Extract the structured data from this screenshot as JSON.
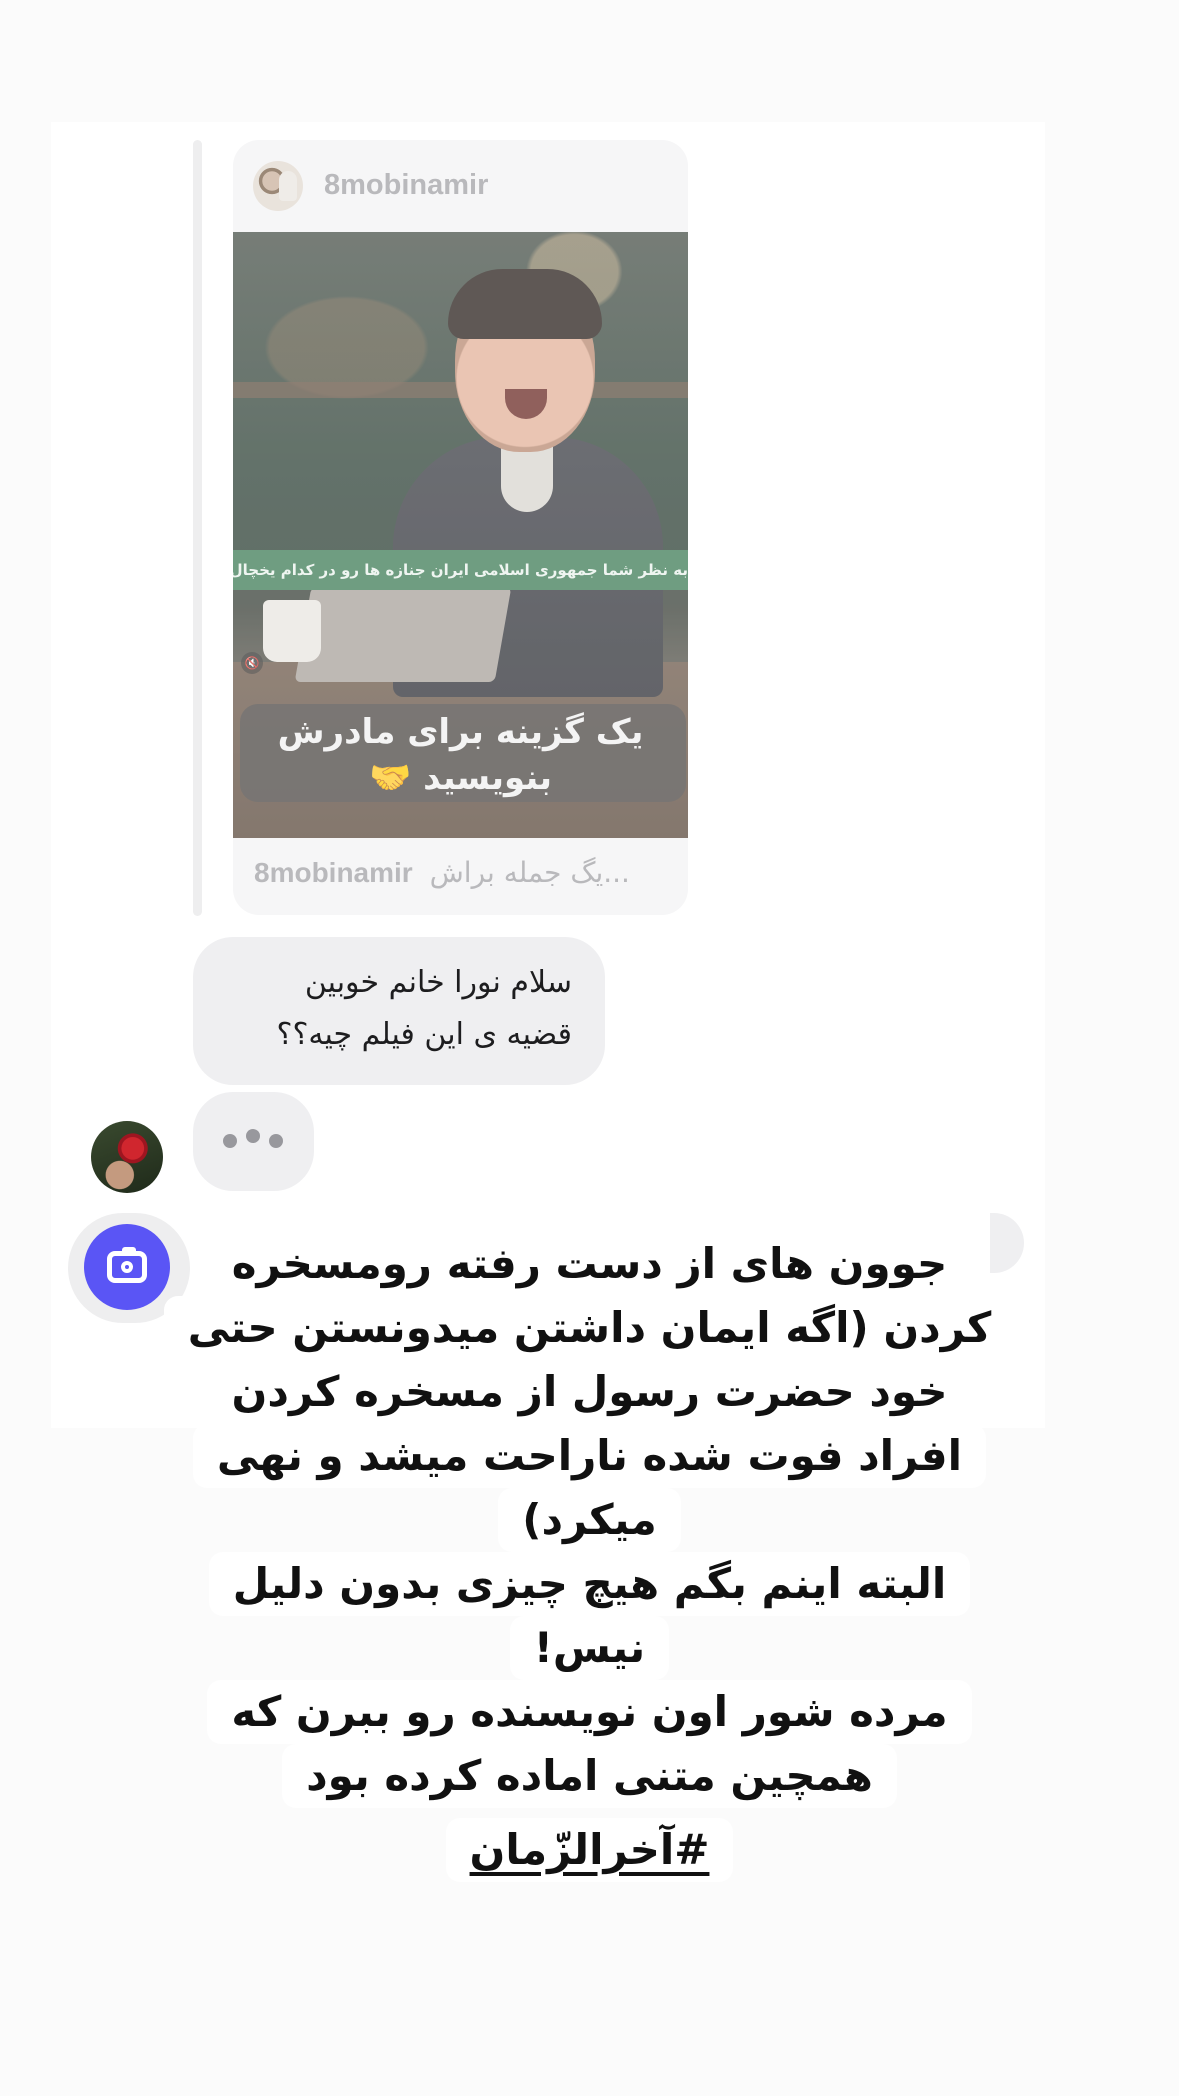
{
  "shared_post": {
    "username": "8mobinamir",
    "caption_strip": "به نظر شما جمهوری اسلامی ایران جنازه ها رو در کدام یخچال نگهداری می کند",
    "overlay_line1": "یک گزینه برای مادرش",
    "overlay_line2": "بنویسید 🤝",
    "footer_username": "8mobinamir",
    "footer_text": "یگ جمله براش..."
  },
  "message": {
    "line1": "سلام نورا خانم خوبین",
    "line2": "قضیه ی این فیلم چیه؟؟"
  },
  "story_text": {
    "lines": [
      "جوون های از دست رفته رومسخره",
      "کردن (اگه ایمان داشتن میدونستن حتی",
      "خود حضرت رسول از مسخره کردن",
      "افراد فوت شده ناراحت میشد و نهی",
      "میکرد)",
      "البته اینم بگم هیچ چیزی بدون دلیل",
      "نیس!",
      "مرده شور اون نویسنده رو ببرن که",
      "همچین متنی اماده کرده بود",
      "#آخرالزّمان"
    ]
  },
  "icons": {
    "camera": "camera-icon",
    "mute": "mute-icon",
    "typing": "typing-indicator"
  },
  "colors": {
    "camera_button": "#5a55f5",
    "bubble": "#efeff1",
    "caption_strip": "#3f7d57"
  }
}
